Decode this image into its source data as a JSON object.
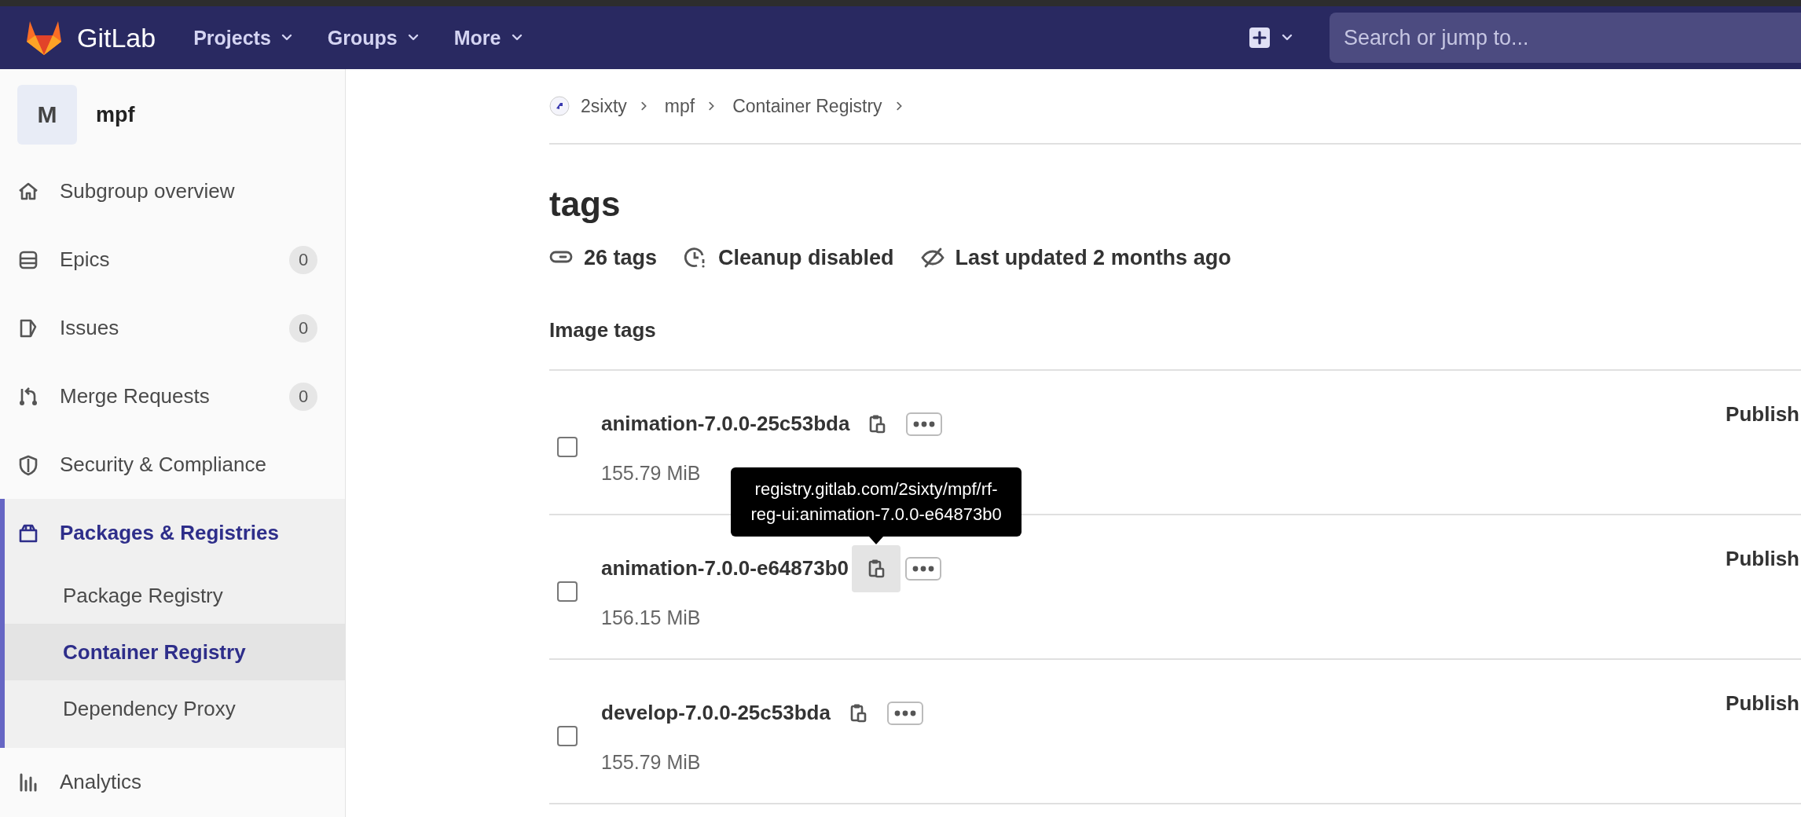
{
  "navbar": {
    "brand": "GitLab",
    "menus": [
      {
        "label": "Projects"
      },
      {
        "label": "Groups"
      },
      {
        "label": "More"
      }
    ],
    "search": {
      "placeholder": "Search or jump to..."
    }
  },
  "sidebar": {
    "avatar": "M",
    "group": "mpf",
    "items": [
      {
        "label": "Subgroup overview",
        "selected": false
      },
      {
        "label": "Epics",
        "count": "0",
        "selected": false
      },
      {
        "label": "Issues",
        "count": "0",
        "selected": false
      },
      {
        "label": "Merge Requests",
        "count": "0",
        "selected": false
      },
      {
        "label": "Security & Compliance",
        "selected": false
      },
      {
        "label": "Packages & Registries",
        "selected": true,
        "expanded": true,
        "children": [
          {
            "label": "Package Registry",
            "selected": false
          },
          {
            "label": "Container Registry",
            "selected": true
          },
          {
            "label": "Dependency Proxy",
            "selected": false
          }
        ]
      },
      {
        "label": "Analytics",
        "selected": false
      }
    ]
  },
  "breadcrumbs": [
    "2sixty",
    "mpf",
    "Container Registry"
  ],
  "title": "tags",
  "meta": [
    "26 tags",
    "Cleanup disabled",
    "Last updated 2 months ago"
  ],
  "section_title": "Image tags",
  "rows": [
    {
      "name": "animation-7.0.0-25c53bda",
      "size": "155.79 MiB",
      "checked": false,
      "published": "Publish",
      "hovered": false
    },
    {
      "name": "animation-7.0.0-e64873b0",
      "size": "156.15 MiB",
      "checked": false,
      "published": "Publish",
      "hovered": true,
      "tooltip": "registry.gitlab.com/2sixty/mpf/rf-reg-ui:animation-7.0.0-e64873b0"
    },
    {
      "name": "develop-7.0.0-25c53bda",
      "size": "155.79 MiB",
      "checked": false,
      "published": "Publish",
      "hovered": false
    }
  ]
}
